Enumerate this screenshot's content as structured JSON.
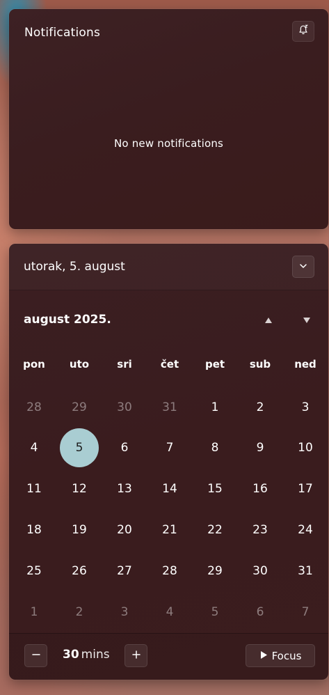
{
  "notifications": {
    "title": "Notifications",
    "empty_text": "No new notifications",
    "settings_icon": "focus-assist-icon"
  },
  "calendar": {
    "header_date": "utorak, 5. august",
    "collapse_icon": "chevron-down-icon",
    "month_label": "august 2025.",
    "nav_up_icon": "triangle-up-icon",
    "nav_down_icon": "triangle-down-icon",
    "weekdays": [
      "pon",
      "uto",
      "sri",
      "čet",
      "pet",
      "sub",
      "ned"
    ],
    "weeks": [
      [
        {
          "d": "28",
          "muted": true
        },
        {
          "d": "29",
          "muted": true
        },
        {
          "d": "30",
          "muted": true
        },
        {
          "d": "31",
          "muted": true
        },
        {
          "d": "1"
        },
        {
          "d": "2"
        },
        {
          "d": "3"
        }
      ],
      [
        {
          "d": "4"
        },
        {
          "d": "5",
          "today": true
        },
        {
          "d": "6"
        },
        {
          "d": "7"
        },
        {
          "d": "8"
        },
        {
          "d": "9"
        },
        {
          "d": "10"
        }
      ],
      [
        {
          "d": "11"
        },
        {
          "d": "12"
        },
        {
          "d": "13"
        },
        {
          "d": "14"
        },
        {
          "d": "15"
        },
        {
          "d": "16"
        },
        {
          "d": "17"
        }
      ],
      [
        {
          "d": "18"
        },
        {
          "d": "19"
        },
        {
          "d": "20"
        },
        {
          "d": "21"
        },
        {
          "d": "22"
        },
        {
          "d": "23"
        },
        {
          "d": "24"
        }
      ],
      [
        {
          "d": "25"
        },
        {
          "d": "26"
        },
        {
          "d": "27"
        },
        {
          "d": "28"
        },
        {
          "d": "29"
        },
        {
          "d": "30"
        },
        {
          "d": "31"
        }
      ],
      [
        {
          "d": "1",
          "muted": true
        },
        {
          "d": "2",
          "muted": true
        },
        {
          "d": "3",
          "muted": true
        },
        {
          "d": "4",
          "muted": true
        },
        {
          "d": "5",
          "muted": true
        },
        {
          "d": "6",
          "muted": true
        },
        {
          "d": "7",
          "muted": true
        }
      ]
    ],
    "today_color": "#a9cdd2"
  },
  "focus": {
    "minus_icon": "minus-icon",
    "minutes_value": "30",
    "minutes_unit": "mins",
    "plus_icon": "plus-icon",
    "button_label": "Focus",
    "button_icon": "play-icon"
  }
}
